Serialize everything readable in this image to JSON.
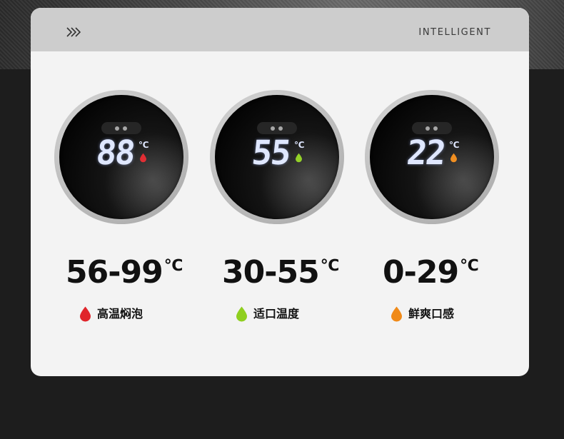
{
  "header": {
    "title": "INTELLIGENT",
    "icon": "triple-chevron-right-icon"
  },
  "dials": [
    {
      "digits": "88",
      "unit": "℃",
      "drop_color": "#e0252b",
      "range": "56-99",
      "range_unit": "℃",
      "caption": "高温焖泡"
    },
    {
      "digits": "55",
      "unit": "℃",
      "drop_color": "#8fcf1f",
      "range": "30-55",
      "range_unit": "℃",
      "caption": "适口温度"
    },
    {
      "digits": "22",
      "unit": "℃",
      "drop_color": "#f08a18",
      "range": "0-29",
      "range_unit": "℃",
      "caption": "鲜爽口感"
    }
  ],
  "colors": {
    "card": "#f3f3f3",
    "header": "#cdcdcd",
    "background": "#1d1d1d",
    "lcd": "#dfe7ff"
  }
}
